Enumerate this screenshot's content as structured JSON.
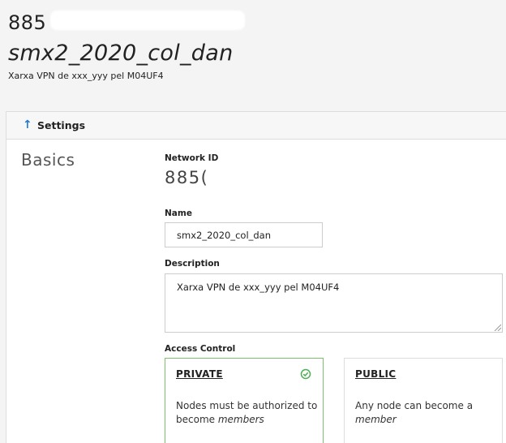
{
  "header": {
    "network_id": "885",
    "network_name": "smx2_2020_col_dan",
    "network_description": "Xarxa VPN de xxx_yyy pel M04UF4"
  },
  "settings": {
    "section_label": "Settings",
    "arrow_icon": "up-arrow-icon",
    "accent_color": "#1e7ad6"
  },
  "basics": {
    "heading": "Basics",
    "network_id_label": "Network ID",
    "network_id_value": "885(",
    "name_label": "Name",
    "name_value": "smx2_2020_col_dan",
    "description_label": "Description",
    "description_value": "Xarxa VPN de xxx_yyy pel M04UF4",
    "access_control_label": "Access Control"
  },
  "access": {
    "private": {
      "title": "PRIVATE",
      "selected": true,
      "icon": "check-circle-icon",
      "color": "#7bc36a",
      "body_text": "Nodes must be authorized to become ",
      "body_em": "members"
    },
    "public": {
      "title": "PUBLIC",
      "selected": false,
      "body_text": "Any node can become a ",
      "body_em": "member"
    }
  }
}
